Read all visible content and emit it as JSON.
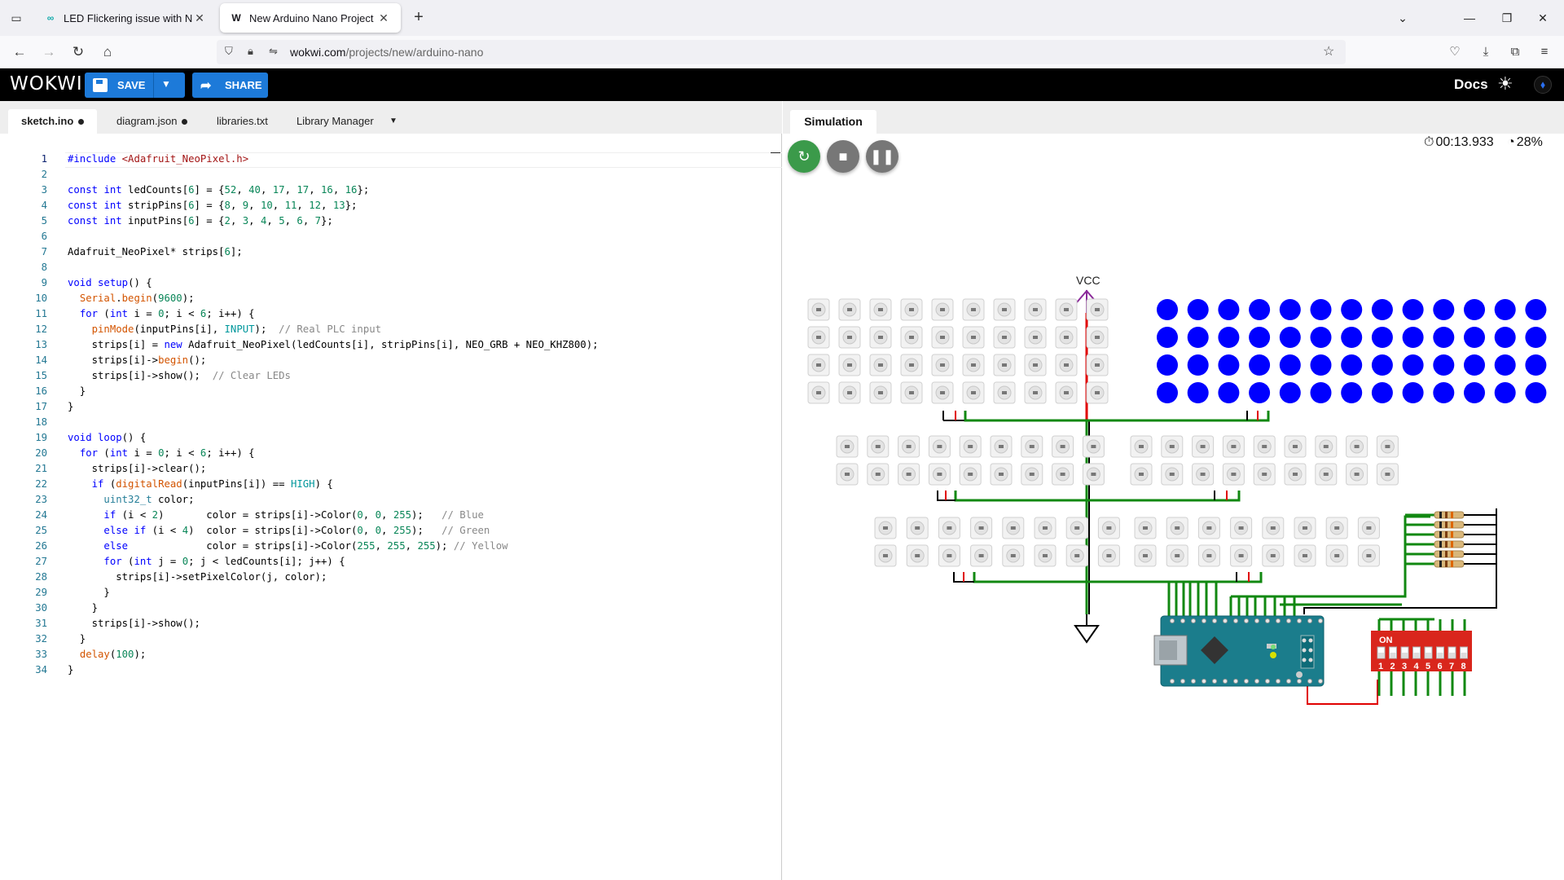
{
  "browser": {
    "tabs": [
      {
        "title": "LED Flickering issue with Neost",
        "icon": "wokwi-favicon-icon"
      },
      {
        "title": "New Arduino Nano Project - W",
        "icon": "wokwi-w-favicon-icon"
      }
    ],
    "url_host": "wokwi.com",
    "url_path": "/projects/new/arduino-nano"
  },
  "header": {
    "logo": "WOKWI",
    "save_label": "SAVE",
    "share_label": "SHARE",
    "docs_label": "Docs"
  },
  "editor": {
    "tabs": [
      {
        "label": "sketch.ino",
        "modified": true
      },
      {
        "label": "diagram.json",
        "modified": true
      },
      {
        "label": "libraries.txt",
        "modified": false
      },
      {
        "label": "Library Manager",
        "modified": false
      }
    ]
  },
  "simulation": {
    "tab_label": "Simulation",
    "time": "00:13.933",
    "speed": "28%",
    "vcc_label": "VCC",
    "dip_on_label": "ON",
    "dip_numbers": [
      "1",
      "2",
      "3",
      "4",
      "5",
      "6",
      "7",
      "8"
    ],
    "led_lit_color": "#0000ff",
    "wire_colors": {
      "vcc": "#e00000",
      "gnd": "#000000",
      "data": "#118811"
    }
  }
}
